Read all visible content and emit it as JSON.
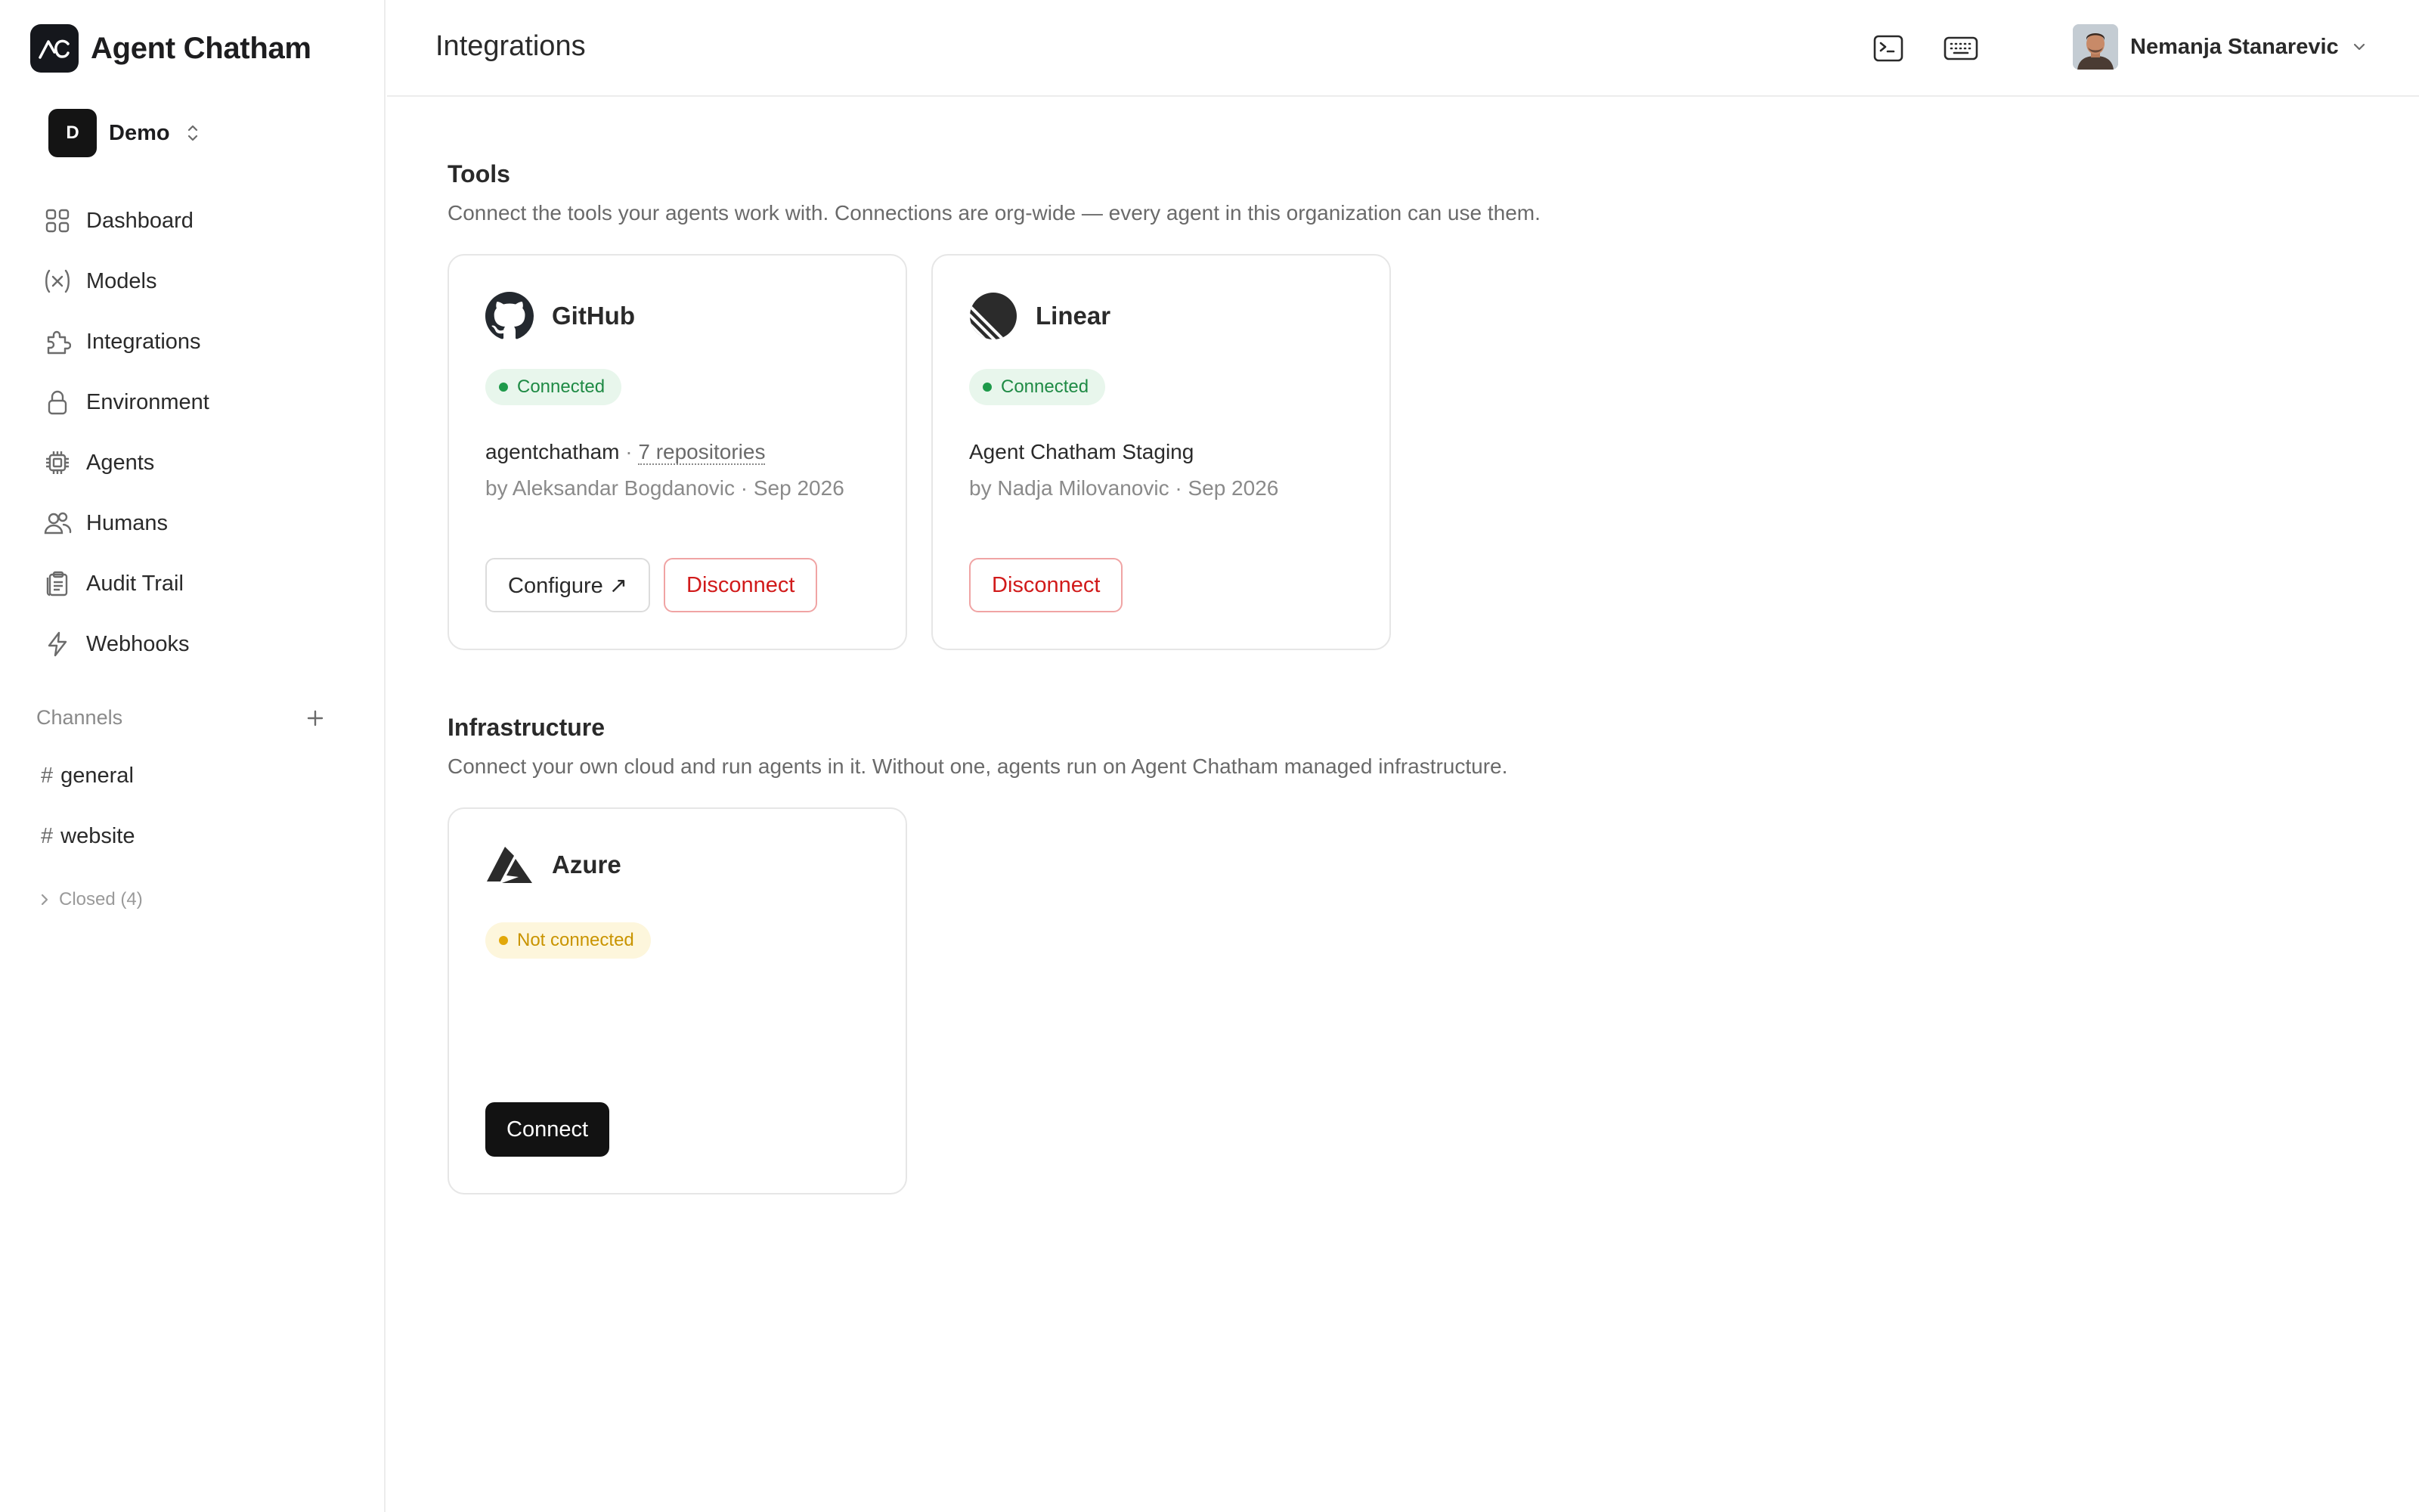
{
  "brand": {
    "name": "Agent Chatham",
    "logo_icon": "agent-chatham-logo"
  },
  "org": {
    "initial": "D",
    "name": "Demo"
  },
  "nav": [
    {
      "label": "Dashboard",
      "icon": "grid-icon"
    },
    {
      "label": "Models",
      "icon": "variable-icon"
    },
    {
      "label": "Integrations",
      "icon": "puzzle-icon"
    },
    {
      "label": "Environment",
      "icon": "lock-icon"
    },
    {
      "label": "Agents",
      "icon": "chip-icon"
    },
    {
      "label": "Humans",
      "icon": "users-icon"
    },
    {
      "label": "Audit Trail",
      "icon": "clipboard-icon"
    },
    {
      "label": "Webhooks",
      "icon": "bolt-icon"
    }
  ],
  "channels": {
    "heading": "Channels",
    "items": [
      {
        "name": "general"
      },
      {
        "name": "website"
      }
    ],
    "closed_label": "Closed (4)"
  },
  "header": {
    "title": "Integrations",
    "user_name": "Nemanja Stanarevic"
  },
  "tools": {
    "title": "Tools",
    "description": "Connect the tools your agents work with. Connections are org-wide — every agent in this organization can use them.",
    "cards": [
      {
        "name": "GitHub",
        "status": "Connected",
        "account": "agentchatham",
        "separator": " · ",
        "detail_link": "7 repositories",
        "meta": "by Aleksandar Bogdanovic · Sep 2026",
        "configure_label": "Configure ↗",
        "disconnect_label": "Disconnect"
      },
      {
        "name": "Linear",
        "status": "Connected",
        "account": "Agent Chatham Staging",
        "meta": "by Nadja Milovanovic · Sep 2026",
        "disconnect_label": "Disconnect"
      }
    ]
  },
  "infrastructure": {
    "title": "Infrastructure",
    "description": "Connect your own cloud and run agents in it. Without one, agents run on Agent Chatham managed infrastructure.",
    "cards": [
      {
        "name": "Azure",
        "status": "Not connected",
        "connect_label": "Connect"
      }
    ]
  },
  "colors": {
    "connected": "#1e8a44",
    "not_connected": "#c99400",
    "danger": "#d11a1a",
    "primary_button": "#121212"
  }
}
